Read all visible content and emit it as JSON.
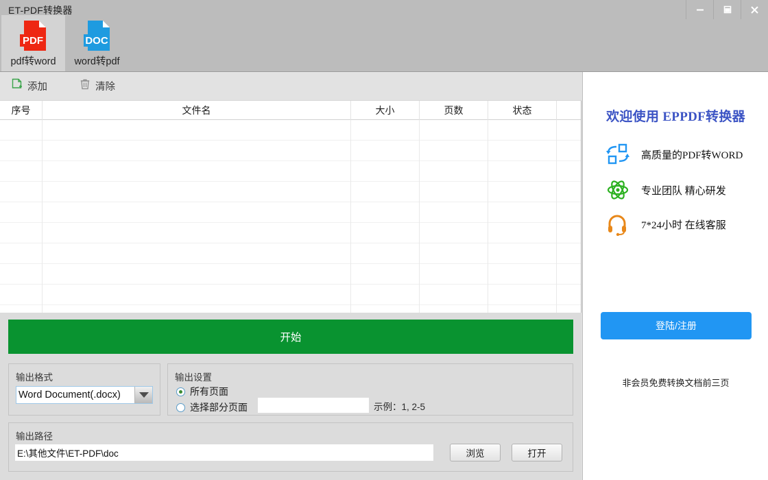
{
  "window": {
    "title": "ET-PDF转换器",
    "controls": [
      {
        "name": "minimize-button",
        "glyph": "minimize"
      },
      {
        "name": "maximize-button",
        "glyph": "maximize"
      },
      {
        "name": "close-button",
        "glyph": "close"
      }
    ]
  },
  "tabs": [
    {
      "label": "pdf转word",
      "icon": "pdf-file-icon",
      "badge": "PDF",
      "color": "#ee2712",
      "active": true
    },
    {
      "label": "word转pdf",
      "icon": "doc-file-icon",
      "badge": "DOC",
      "color": "#1e9be0",
      "active": false
    }
  ],
  "toolbar": {
    "add_label": "添加",
    "add_icon": "add-file-icon",
    "clear_label": "清除",
    "clear_icon": "trash-icon"
  },
  "table": {
    "columns": [
      "序号",
      "文件名",
      "大小",
      "页数",
      "状态",
      ""
    ],
    "rows": [],
    "empty_row_count": 10
  },
  "actions": {
    "start_label": "开始",
    "start_color": "#099330"
  },
  "output_format": {
    "group_title": "输出格式",
    "selected": "Word Document(.docx)",
    "options": [
      "Word Document(.docx)"
    ]
  },
  "output_settings": {
    "group_title": "输出设置",
    "all_pages_label": "所有页面",
    "all_pages_selected": true,
    "partial_pages_label": "选择部分页面",
    "partial_pages_selected": false,
    "pages_value": "",
    "pages_placeholder": "",
    "example_text": "示例：1, 2-5"
  },
  "output_path": {
    "group_title": "输出路径",
    "value": "E:\\其他文件\\ET-PDF\\doc",
    "browse_label": "浏览",
    "open_label": "打开"
  },
  "side_panel": {
    "title": "欢迎使用 EPPDF转换器",
    "title_color": "#3b53c4",
    "features": [
      {
        "text": "高质量的PDF转WORD",
        "icon": "convert-arrows-icon",
        "color": "#2196f3"
      },
      {
        "text": "专业团队 精心研发",
        "icon": "atom-icon",
        "color": "#2bb11f"
      },
      {
        "text": "7*24小时 在线客服",
        "icon": "headset-icon",
        "color": "#e8881a"
      }
    ],
    "login_label": "登陆/注册",
    "login_color": "#2196f3",
    "member_note": "非会员免费转换文档前三页"
  }
}
